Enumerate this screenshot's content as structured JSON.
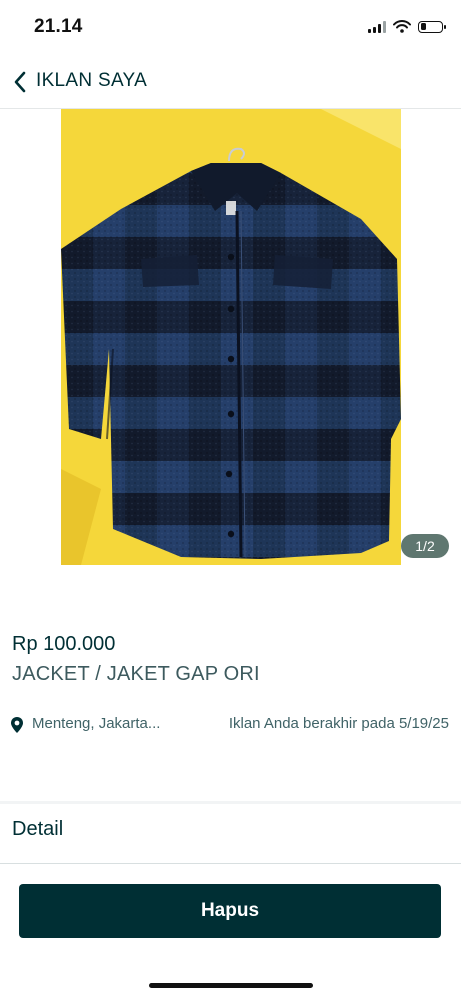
{
  "status_bar": {
    "time": "21.14",
    "icons": [
      "signal-icon",
      "wifi-icon",
      "battery-icon"
    ],
    "battery_level": 0.25
  },
  "header": {
    "title": "IKLAN SAYA",
    "back_icon": "chevron-left-icon"
  },
  "gallery": {
    "counter": "1/2",
    "image_subject": "navy buffalo-check fleece shirt jacket on a hanger over a yellow background"
  },
  "listing": {
    "price": "Rp 100.000",
    "title": "JACKET / JAKET GAP ORI",
    "location": "Menteng, Jakarta...",
    "expiry": "Iklan Anda berakhir pada 5/19/25",
    "location_icon": "map-pin-icon"
  },
  "detail": {
    "label": "Detail"
  },
  "actions": {
    "delete_label": "Hapus"
  },
  "colors": {
    "brand_dark": "#002f34",
    "text_secondary": "#406367",
    "counter_bg": "#5f7770",
    "photo_background": "#f5d73a"
  }
}
